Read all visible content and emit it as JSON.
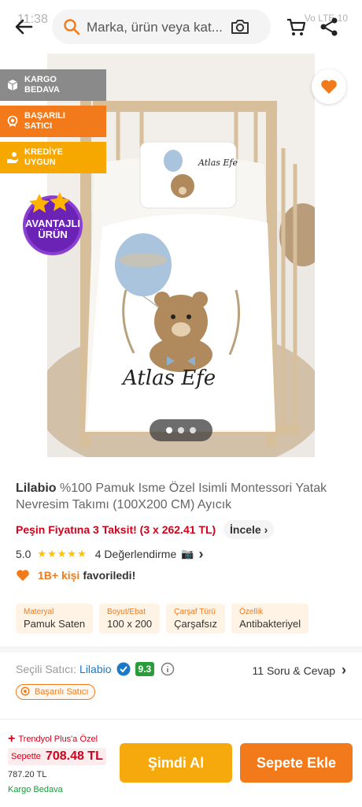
{
  "status": {
    "time": "11:38",
    "right": "Vo LTE 10"
  },
  "search": {
    "placeholder": "Marka, ürün veya kat..."
  },
  "badges": {
    "kargo": "KARGO BEDAVA",
    "satici": "BAŞARILI SATICI",
    "kredi": "KREDİYE UYGUN",
    "avantajli_line1": "AVANTAJLI",
    "avantajli_line2": "ÜRÜN"
  },
  "product_image": {
    "print_text": "Atlas Efe",
    "pillow_text": "Atlas Efe"
  },
  "gallery": {
    "count": 3,
    "active_index": 0
  },
  "product": {
    "brand": "Lilabio",
    "title": "%100 Pamuk Isme Özel Isimli Montessori Yatak Nevresim Takımı (100X200 CM) Ayıcık",
    "installment": "Peşin Fiyatına 3 Taksit! (3 x 262.41 TL)",
    "incele": "İncele",
    "rating": "5.0",
    "stars": 5,
    "reviews": "4 Değerlendirme",
    "fav_count": "1B+ kişi",
    "fav_text": "favoriledi!"
  },
  "attributes": [
    {
      "label": "Materyal",
      "value": "Pamuk Saten"
    },
    {
      "label": "Boyut/Ebat",
      "value": "100 x 200"
    },
    {
      "label": "Çarşaf Türü",
      "value": "Çarşafsız"
    },
    {
      "label": "Özellik",
      "value": "Antibakteriyel"
    }
  ],
  "seller": {
    "label": "Seçili Satıcı:",
    "name": "Lilabio",
    "score": "9.3",
    "qa": "11 Soru & Cevap",
    "badge": "Başarılı Satıcı"
  },
  "bottom": {
    "plus": "Trendyol Plus'a Özel",
    "sepette_label": "Sepette",
    "sepette_price": "708.48 TL",
    "old_price": "787.20 TL",
    "kargo": "Kargo Bedava",
    "buy": "Şimdi Al",
    "add": "Sepete Ekle"
  },
  "colors": {
    "accent": "#f27a1a",
    "yellow": "#f6a90d",
    "red": "#d0021b",
    "score_green": "#2a9d3a",
    "link": "#1c79c5"
  }
}
